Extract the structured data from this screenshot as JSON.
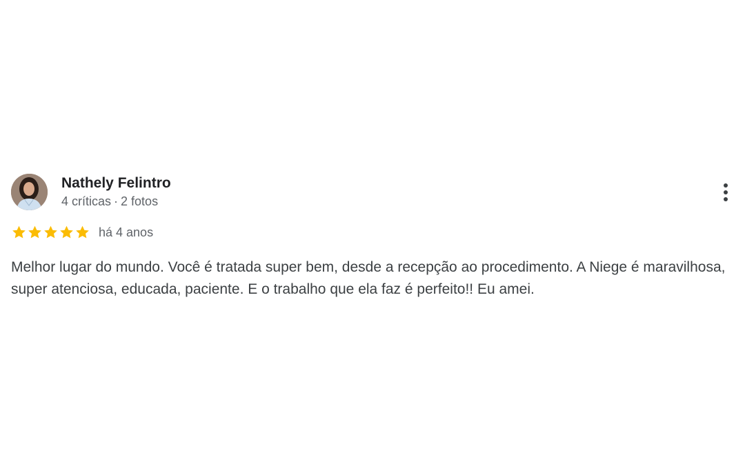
{
  "review": {
    "author": {
      "name": "Nathely Felintro",
      "reviews_count": "4 críticas",
      "separator": "·",
      "photos_count": "2 fotos",
      "avatar_icon": "user-avatar-photo"
    },
    "rating": {
      "stars": 5,
      "max": 5,
      "star_color": "#fbbc04",
      "star_icon": "star-icon"
    },
    "date": "há 4 anos",
    "text": "Melhor lugar do mundo. Você é tratada super bem, desde a recepção ao procedimento. A Niege é maravilhosa, super atenciosa, educada, paciente. E o trabalho que ela faz é perfeito!! Eu amei.",
    "menu_icon": "more-vert-icon"
  }
}
